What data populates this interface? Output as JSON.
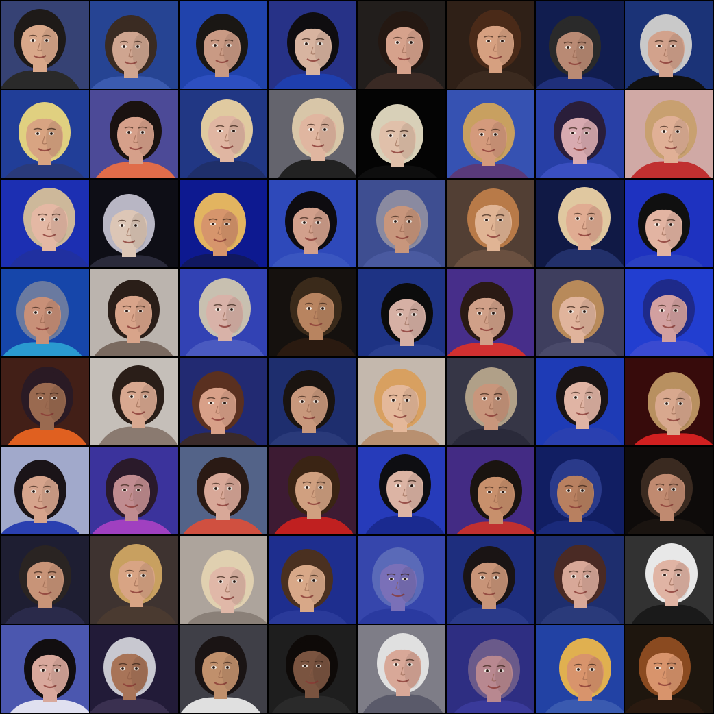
{
  "grid": {
    "rows": 8,
    "columns": 8,
    "tiles": [
      {
        "bg": "#3a4a8c",
        "skin": "#d9a88a",
        "hair": "#1e1a18",
        "accent": "#2a2a2a"
      },
      {
        "bg": "#1f3d8a",
        "skin": "#cfa590",
        "hair": "#3a2b22",
        "accent": "#3b5bb0"
      },
      {
        "bg": "#1d3fa6",
        "skin": "#c99a84",
        "hair": "#1a1714",
        "accent": "#2d4fc0"
      },
      {
        "bg": "#2a2e7a",
        "skin": "#d8b4a0",
        "hair": "#0f0d10",
        "accent": "#1f3fae"
      },
      {
        "bg": "#1a1a1a",
        "skin": "#d6a28c",
        "hair": "#241812",
        "accent": "#3a2a24"
      },
      {
        "bg": "#2b1c14",
        "skin": "#d6a080",
        "hair": "#4a2a18",
        "accent": "#3b2a1f"
      },
      {
        "bg": "#0c1740",
        "skin": "#b98a74",
        "hair": "#2a2a2a",
        "accent": "#1f2f7a"
      },
      {
        "bg": "#1f3f9a",
        "skin": "#d2a28c",
        "hair": "#c9c9c9",
        "accent": "#111111"
      },
      {
        "bg": "#1e3fa2",
        "skin": "#d8a482",
        "hair": "#e0d080",
        "accent": "#2a3a7a"
      },
      {
        "bg": "#1b3fb0",
        "skin": "#d6a08a",
        "hair": "#1a1210",
        "accent": "#e06c4a"
      },
      {
        "bg": "#223a8c",
        "skin": "#e0b6a2",
        "hair": "#e0caa0",
        "accent": "#1f2f6a"
      },
      {
        "bg": "#7a7a86",
        "skin": "#e0b6a0",
        "hair": "#d8c6a8",
        "accent": "#222222"
      },
      {
        "bg": "#000000",
        "skin": "#e0c0aa",
        "hair": "#d8d0b8",
        "accent": "#0e0e0e"
      },
      {
        "bg": "#2a5ac4",
        "skin": "#d49a7c",
        "hair": "#c8a060",
        "accent": "#5a3a7a"
      },
      {
        "bg": "#213a9e",
        "skin": "#d8aab0",
        "hair": "#2a1e3a",
        "accent": "#3a4fc0"
      },
      {
        "bg": "#d6d2cc",
        "skin": "#e0b096",
        "hair": "#c8a070",
        "accent": "#c03030"
      },
      {
        "bg": "#1b2fb8",
        "skin": "#e4b8a4",
        "hair": "#cdb89a",
        "accent": "#2030a0"
      },
      {
        "bg": "#05050a",
        "skin": "#dcc6b6",
        "hair": "#b8b6c4",
        "accent": "#2a2a3a"
      },
      {
        "bg": "#0d1aa0",
        "skin": "#d6956c",
        "hair": "#e2b460",
        "accent": "#101860"
      },
      {
        "bg": "#2a44b8",
        "skin": "#d2a08c",
        "hair": "#0e0c10",
        "accent": "#3a56c0"
      },
      {
        "bg": "#3a4a8c",
        "skin": "#c8967c",
        "hair": "#8a8aa0",
        "accent": "#4a5aa0"
      },
      {
        "bg": "#4a3a30",
        "skin": "#e0b494",
        "hair": "#b87a48",
        "accent": "#6a5040"
      },
      {
        "bg": "#0a1238",
        "skin": "#e0ac92",
        "hair": "#e0c8a0",
        "accent": "#22306a"
      },
      {
        "bg": "#1a2ec0",
        "skin": "#e2b4a2",
        "hair": "#101010",
        "accent": "#2a40c0"
      },
      {
        "bg": "#0f2a9e",
        "skin": "#c89078",
        "hair": "#6a7aa0",
        "accent": "#2a9ad0"
      },
      {
        "bg": "#d0ccc8",
        "skin": "#d8a48a",
        "hair": "#2a1e18",
        "accent": "#7a6a60"
      },
      {
        "bg": "#2a3ab0",
        "skin": "#d8b2a8",
        "hair": "#c8c0b0",
        "accent": "#4a5ac0"
      },
      {
        "bg": "#0e0e0e",
        "skin": "#b88460",
        "hair": "#3a2a1a",
        "accent": "#2a1a10"
      },
      {
        "bg": "#1a2f80",
        "skin": "#d6b0a4",
        "hair": "#0c0c0c",
        "accent": "#2a3f90"
      },
      {
        "bg": "#1a2ea8",
        "skin": "#d0a088",
        "hair": "#2a1a14",
        "accent": "#d03030"
      },
      {
        "bg": "#3a3a5a",
        "skin": "#e0b49c",
        "hair": "#b88a5a",
        "accent": "#4a4a6a"
      },
      {
        "bg": "#1a3ad0",
        "skin": "#d2a0a0",
        "hair": "#1e2a8a",
        "accent": "#3a4ad0"
      },
      {
        "bg": "#0e0a14",
        "skin": "#9a6a50",
        "hair": "#2a1a24",
        "accent": "#e06020"
      },
      {
        "bg": "#d8d6d2",
        "skin": "#d8a890",
        "hair": "#2a1e18",
        "accent": "#8a7a70"
      },
      {
        "bg": "#1a2a8a",
        "skin": "#d8a088",
        "hair": "#5a3020",
        "accent": "#3a2a2a"
      },
      {
        "bg": "#1a2a6a",
        "skin": "#c8987c",
        "hair": "#1a1410",
        "accent": "#2a3a7a"
      },
      {
        "bg": "#c8c6c2",
        "skin": "#e4b89a",
        "hair": "#d8a060",
        "accent": "#b89070"
      },
      {
        "bg": "#3a3a4a",
        "skin": "#c8967c",
        "hair": "#b0a088",
        "accent": "#2a2a3a"
      },
      {
        "bg": "#1a3ab8",
        "skin": "#e0b4a4",
        "hair": "#1a1414",
        "accent": "#2a40b0"
      },
      {
        "bg": "#050505",
        "skin": "#d8a88e",
        "hair": "#b89060",
        "accent": "#d02020"
      },
      {
        "bg": "#c8ccd4",
        "skin": "#d6a48c",
        "hair": "#1a1418",
        "accent": "#2a40b0"
      },
      {
        "bg": "#1a2f90",
        "skin": "#c08c90",
        "hair": "#2a1a2a",
        "accent": "#a040c0"
      },
      {
        "bg": "#2a6aa0",
        "skin": "#d8a898",
        "hair": "#2a1a14",
        "accent": "#d05040"
      },
      {
        "bg": "#121a3a",
        "skin": "#d0a080",
        "hair": "#3a2414",
        "accent": "#c02020"
      },
      {
        "bg": "#2a40c8",
        "skin": "#dcb4a4",
        "hair": "#0e0e12",
        "accent": "#1a2a90"
      },
      {
        "bg": "#1a2aa0",
        "skin": "#c8906c",
        "hair": "#1a1410",
        "accent": "#c03030"
      },
      {
        "bg": "#0e1a5a",
        "skin": "#b88060",
        "hair": "#2a3a8a",
        "accent": "#1a2a7a"
      },
      {
        "bg": "#0a0808",
        "skin": "#c08a70",
        "hair": "#3a2a20",
        "accent": "#1a1410"
      },
      {
        "bg": "#1a1a2a",
        "skin": "#c89478",
        "hair": "#2a2422",
        "accent": "#2a2a4a"
      },
      {
        "bg": "#3a3030",
        "skin": "#d8a484",
        "hair": "#c8a060",
        "accent": "#4a3a30"
      },
      {
        "bg": "#b8b0a8",
        "skin": "#e0b8a8",
        "hair": "#e0d0b0",
        "accent": "#8a8078"
      },
      {
        "bg": "#1a2a8a",
        "skin": "#d8a888",
        "hair": "#4a3020",
        "accent": "#2a3a9a"
      },
      {
        "bg": "#3a4ab0",
        "skin": "#7a70b8",
        "hair": "#5a6ab8",
        "accent": "#2a3aa0"
      },
      {
        "bg": "#1a2a7a",
        "skin": "#c89478",
        "hair": "#1a1414",
        "accent": "#2a3a8a"
      },
      {
        "bg": "#1a2a6a",
        "skin": "#d8a898",
        "hair": "#4a2a24",
        "accent": "#2a3a7a"
      },
      {
        "bg": "#3a3a3a",
        "skin": "#e0b4a4",
        "hair": "#e8e8e8",
        "accent": "#1a1a1a"
      },
      {
        "bg": "#1a2a9a",
        "skin": "#d8a89c",
        "hair": "#120e10",
        "accent": "#e0e0f0"
      },
      {
        "bg": "#1a1430",
        "skin": "#a87458",
        "hair": "#c8c8d0",
        "accent": "#3a3050"
      },
      {
        "bg": "#0a0a14",
        "skin": "#c0906c",
        "hair": "#1a1414",
        "accent": "#e0e0e0"
      },
      {
        "bg": "#1a1a1a",
        "skin": "#7a5440",
        "hair": "#0e0a08",
        "accent": "#2a2a2a"
      },
      {
        "bg": "#8a8890",
        "skin": "#d8a898",
        "hair": "#e0e0e0",
        "accent": "#5a5a6a"
      },
      {
        "bg": "#2a2a7a",
        "skin": "#b88890",
        "hair": "#6a5a8a",
        "accent": "#3a3a9a"
      },
      {
        "bg": "#1a3aa0",
        "skin": "#d8946c",
        "hair": "#e0b050",
        "accent": "#3a5ab0"
      },
      {
        "bg": "#1a140e",
        "skin": "#d8946c",
        "hair": "#8a4a20",
        "accent": "#2a1a10"
      }
    ]
  }
}
